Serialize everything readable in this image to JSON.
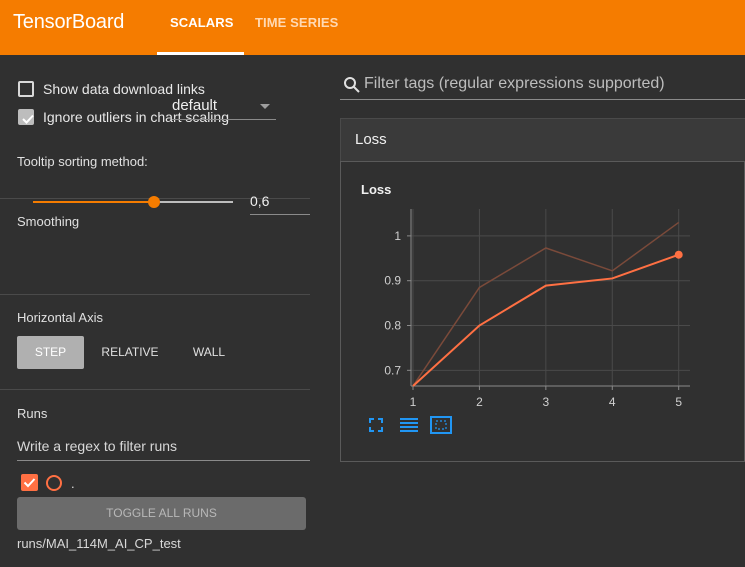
{
  "app": {
    "title": "TensorBoard"
  },
  "tabs": [
    {
      "label": "SCALARS",
      "active": true
    },
    {
      "label": "TIME SERIES",
      "active": false
    }
  ],
  "sidebar": {
    "show_download_label": "Show data download links",
    "ignore_outliers_label": "Ignore outliers in chart scaling",
    "tooltip_label": "Tooltip sorting method:",
    "tooltip_value": "default",
    "smoothing_label": "Smoothing",
    "smoothing_value": "0,6",
    "smoothing_fraction": 0.6,
    "horizontal_axis_label": "Horizontal Axis",
    "axis_buttons": [
      "STEP",
      "RELATIVE",
      "WALL"
    ],
    "runs_label": "Runs",
    "runs_filter_placeholder": "Write a regex to filter runs",
    "run_item_label": ".",
    "toggle_all_label": "TOGGLE ALL RUNS",
    "run_path": "runs/MAI_114M_AI_CP_test"
  },
  "main": {
    "filter_placeholder": "Filter tags (regular expressions supported)",
    "group_title": "Loss",
    "card_title": "Loss"
  },
  "colors": {
    "header": "#f57c00",
    "run": "#ff7043",
    "raw_line": "#7a4a3a"
  },
  "chart_data": {
    "type": "line",
    "title": "Loss",
    "x": [
      1,
      2,
      3,
      4,
      5
    ],
    "xticks": [
      "1",
      "2",
      "3",
      "4",
      "5"
    ],
    "yticks": [
      "0.7",
      "0.8",
      "0.9",
      "1"
    ],
    "ylim": [
      0.665,
      1.06
    ],
    "grid": true,
    "series": [
      {
        "kind": "raw",
        "values": [
          0.665,
          0.885,
          0.973,
          0.922,
          1.03
        ]
      },
      {
        "kind": "smoothed",
        "values": [
          0.665,
          0.8,
          0.889,
          0.905,
          0.958
        ]
      }
    ]
  }
}
